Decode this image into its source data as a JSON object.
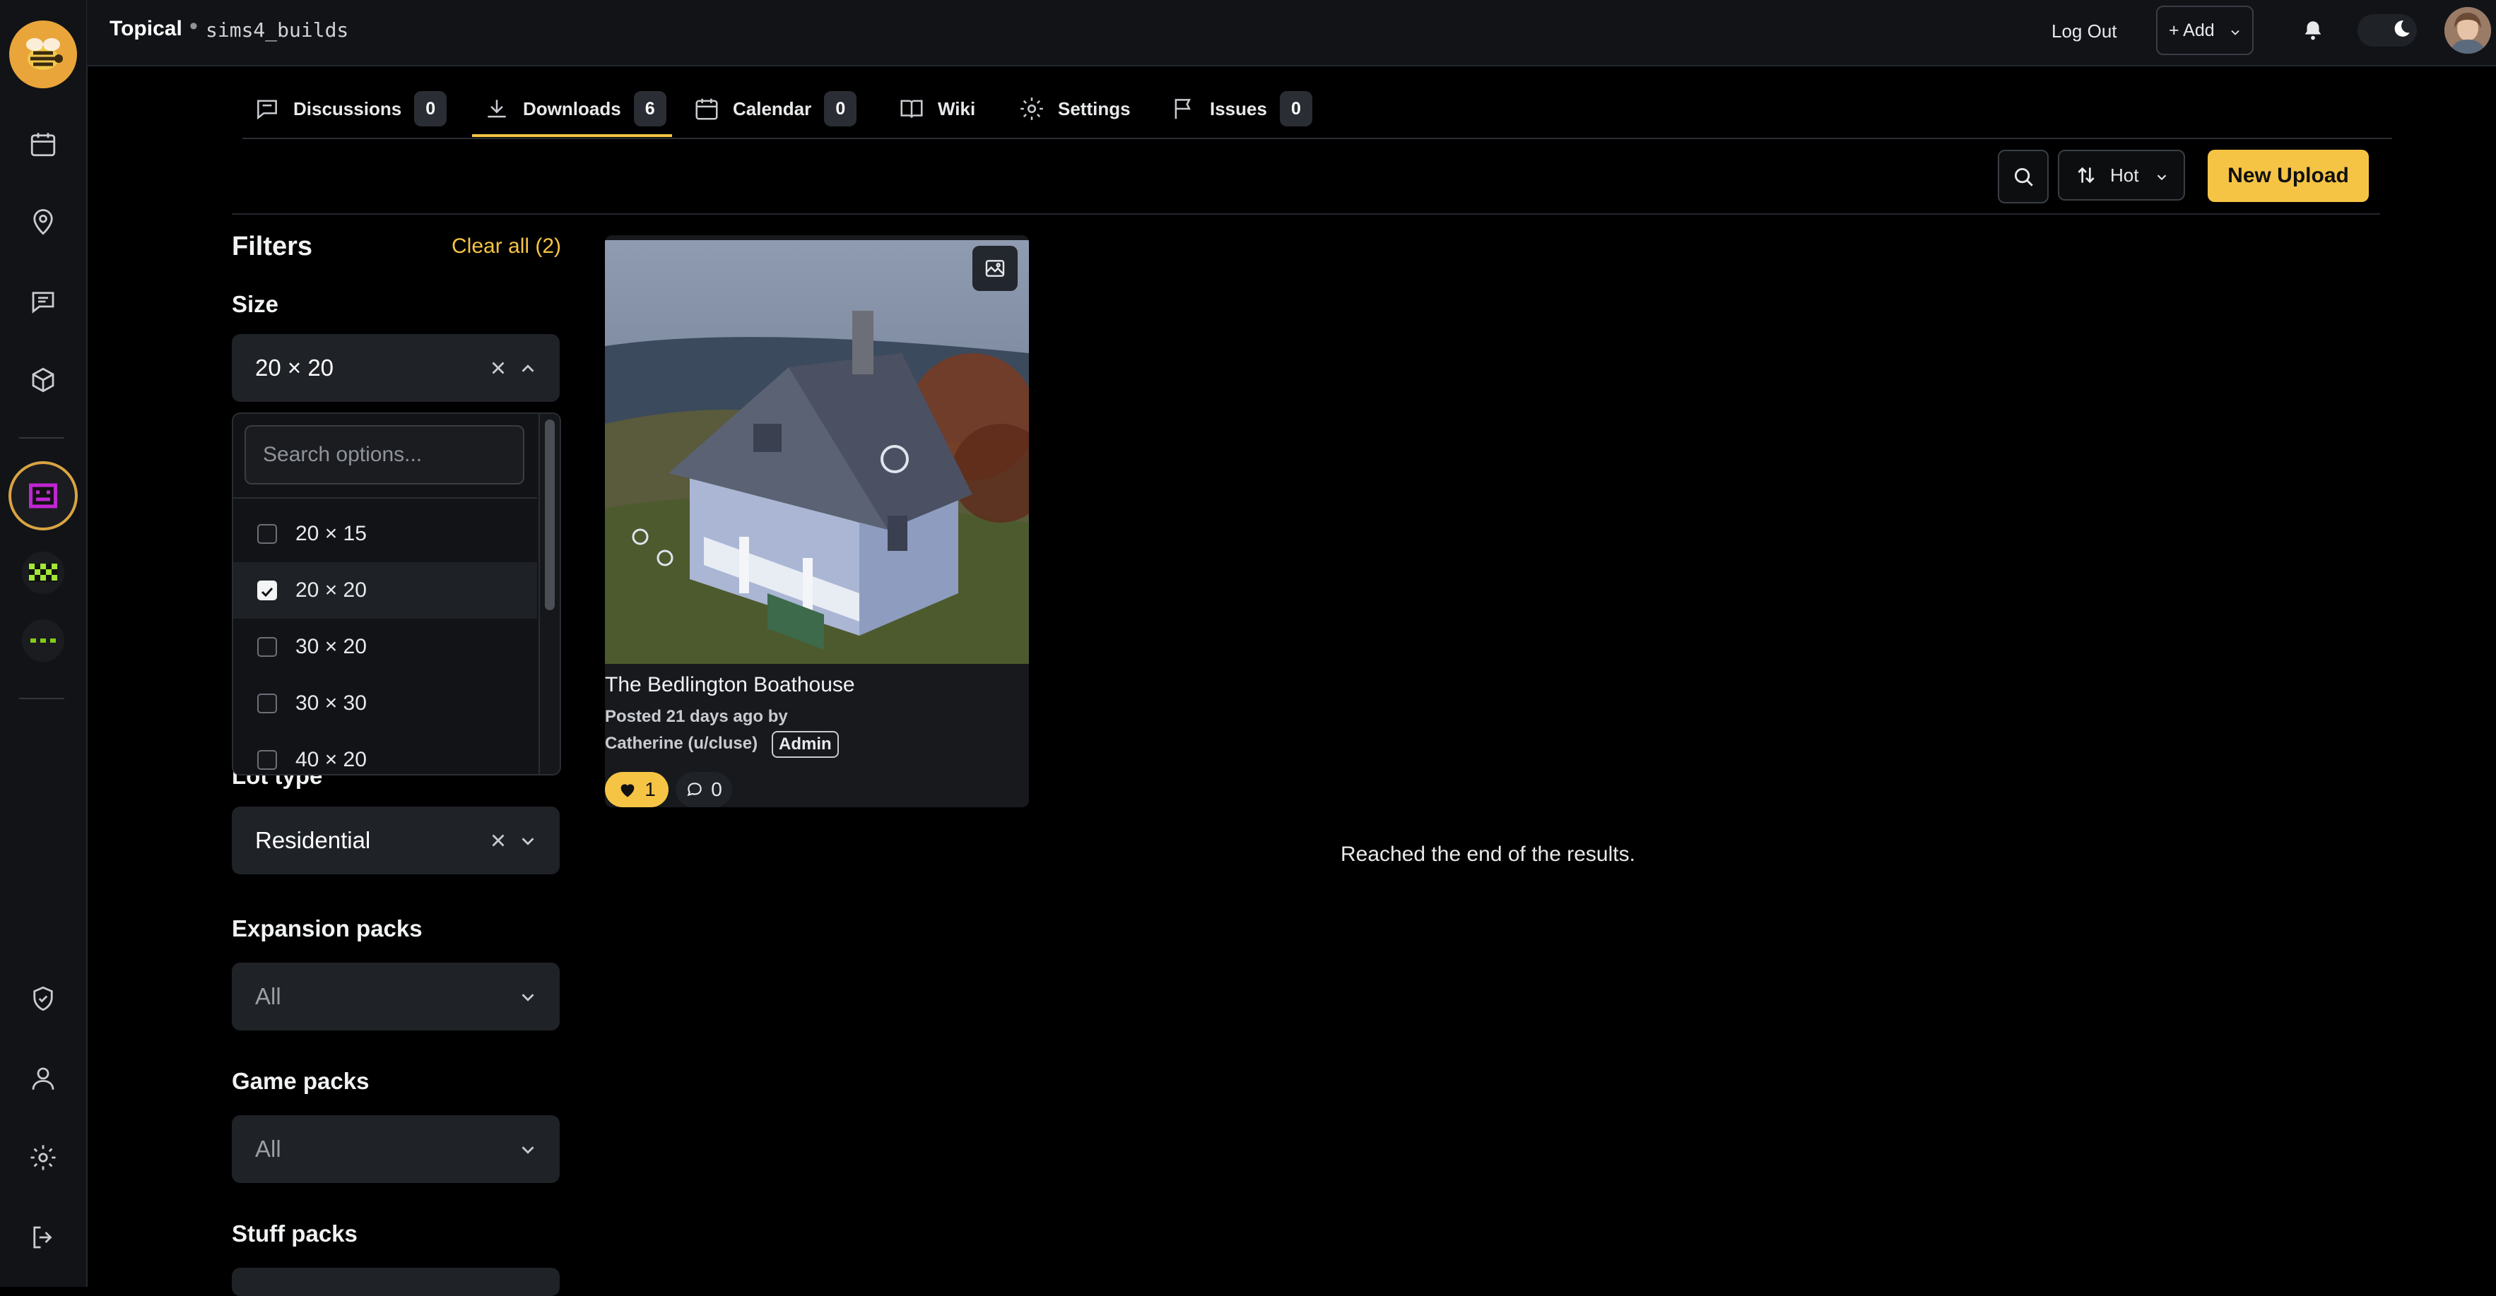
{
  "colors": {
    "accent": "#f6c445",
    "background": "#000000",
    "panel": "#111317",
    "input": "#1f2227"
  },
  "header": {
    "brand": "Topical",
    "separator": "•",
    "forum": "sims4_builds",
    "logout_label": "Log Out",
    "add_label": "+ Add"
  },
  "rail": {
    "items": [
      "calendar-icon",
      "location-icon",
      "chat-icon",
      "cube-icon",
      "forum-avatar-purple",
      "forum-avatar-green",
      "more-dots-icon",
      "shield-icon",
      "user-icon",
      "gear-icon",
      "logout-icon"
    ]
  },
  "tabs": [
    {
      "label": "Discussions",
      "count": "0",
      "icon": "chat-icon"
    },
    {
      "label": "Downloads",
      "count": "6",
      "icon": "download-icon",
      "active": true
    },
    {
      "label": "Calendar",
      "count": "0",
      "icon": "calendar-icon"
    },
    {
      "label": "Wiki",
      "icon": "book-icon"
    },
    {
      "label": "Settings",
      "icon": "gear-icon"
    },
    {
      "label": "Issues",
      "count": "0",
      "icon": "flag-icon"
    }
  ],
  "toolbar": {
    "sort_label": "Hot",
    "new_upload_label": "New Upload"
  },
  "filters": {
    "title": "Filters",
    "clear_all": "Clear all (2)",
    "size": {
      "label": "Size",
      "value": "20 × 20",
      "search_placeholder": "Search options...",
      "options": [
        {
          "label": "20 × 15",
          "checked": false
        },
        {
          "label": "20 × 20",
          "checked": true
        },
        {
          "label": "30 × 20",
          "checked": false
        },
        {
          "label": "30 × 30",
          "checked": false
        },
        {
          "label": "40 × 20",
          "checked": false
        }
      ]
    },
    "lot_type": {
      "label": "Lot type",
      "value": "Residential"
    },
    "expansion_packs": {
      "label": "Expansion packs",
      "value": "All"
    },
    "game_packs": {
      "label": "Game packs",
      "value": "All"
    },
    "stuff_packs": {
      "label": "Stuff packs"
    }
  },
  "results": {
    "cards": [
      {
        "title": "The Bedlington Boathouse",
        "posted": "Posted 21 days ago by",
        "author": "Catherine",
        "username": "(u/cluse)",
        "badge": "Admin",
        "likes": "1",
        "comments": "0"
      }
    ],
    "end_message": "Reached the end of the results."
  }
}
